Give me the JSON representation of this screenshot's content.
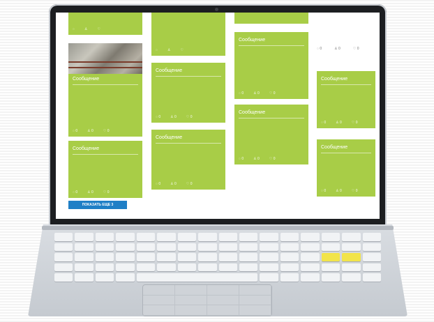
{
  "page": {
    "accent": "#a8cd47",
    "button_color": "#1f7fc6"
  },
  "cards": {
    "col1_top": {
      "icons": [
        "comment-icon",
        "like-icon",
        "heart-icon"
      ]
    },
    "col1_photo": {
      "title": "Сообщение",
      "body": "",
      "counts": [
        "0",
        "0",
        "0"
      ]
    },
    "col1_b": {
      "title": "Сообщение",
      "body": "",
      "counts": [
        "0",
        "0",
        "0"
      ]
    },
    "col2_a": {
      "title": "Сообщение",
      "body": "",
      "counts": [
        "0",
        "0",
        "0"
      ]
    },
    "col2_b": {
      "title": "Сообщение",
      "body": "",
      "counts": [
        "0",
        "0",
        "0"
      ]
    },
    "col3_a": {
      "title": "Сообщение",
      "body": "",
      "counts": [
        "0",
        "0",
        "0"
      ]
    },
    "col3_b": {
      "title": "Сообщение",
      "body": "",
      "counts": [
        "0",
        "0",
        "0"
      ]
    },
    "col4_a": {
      "title": "Сообщение",
      "body": "",
      "counts": [
        "0",
        "0",
        "0"
      ]
    },
    "col4_b": {
      "title": "Сообщение",
      "body": "",
      "counts": [
        "0",
        "0",
        "0"
      ]
    }
  },
  "text_card": {
    "counts": [
      "0",
      "0",
      "0"
    ]
  },
  "show_more": {
    "label": "ПОКАЗАТЬ ЕЩЕ 3"
  }
}
